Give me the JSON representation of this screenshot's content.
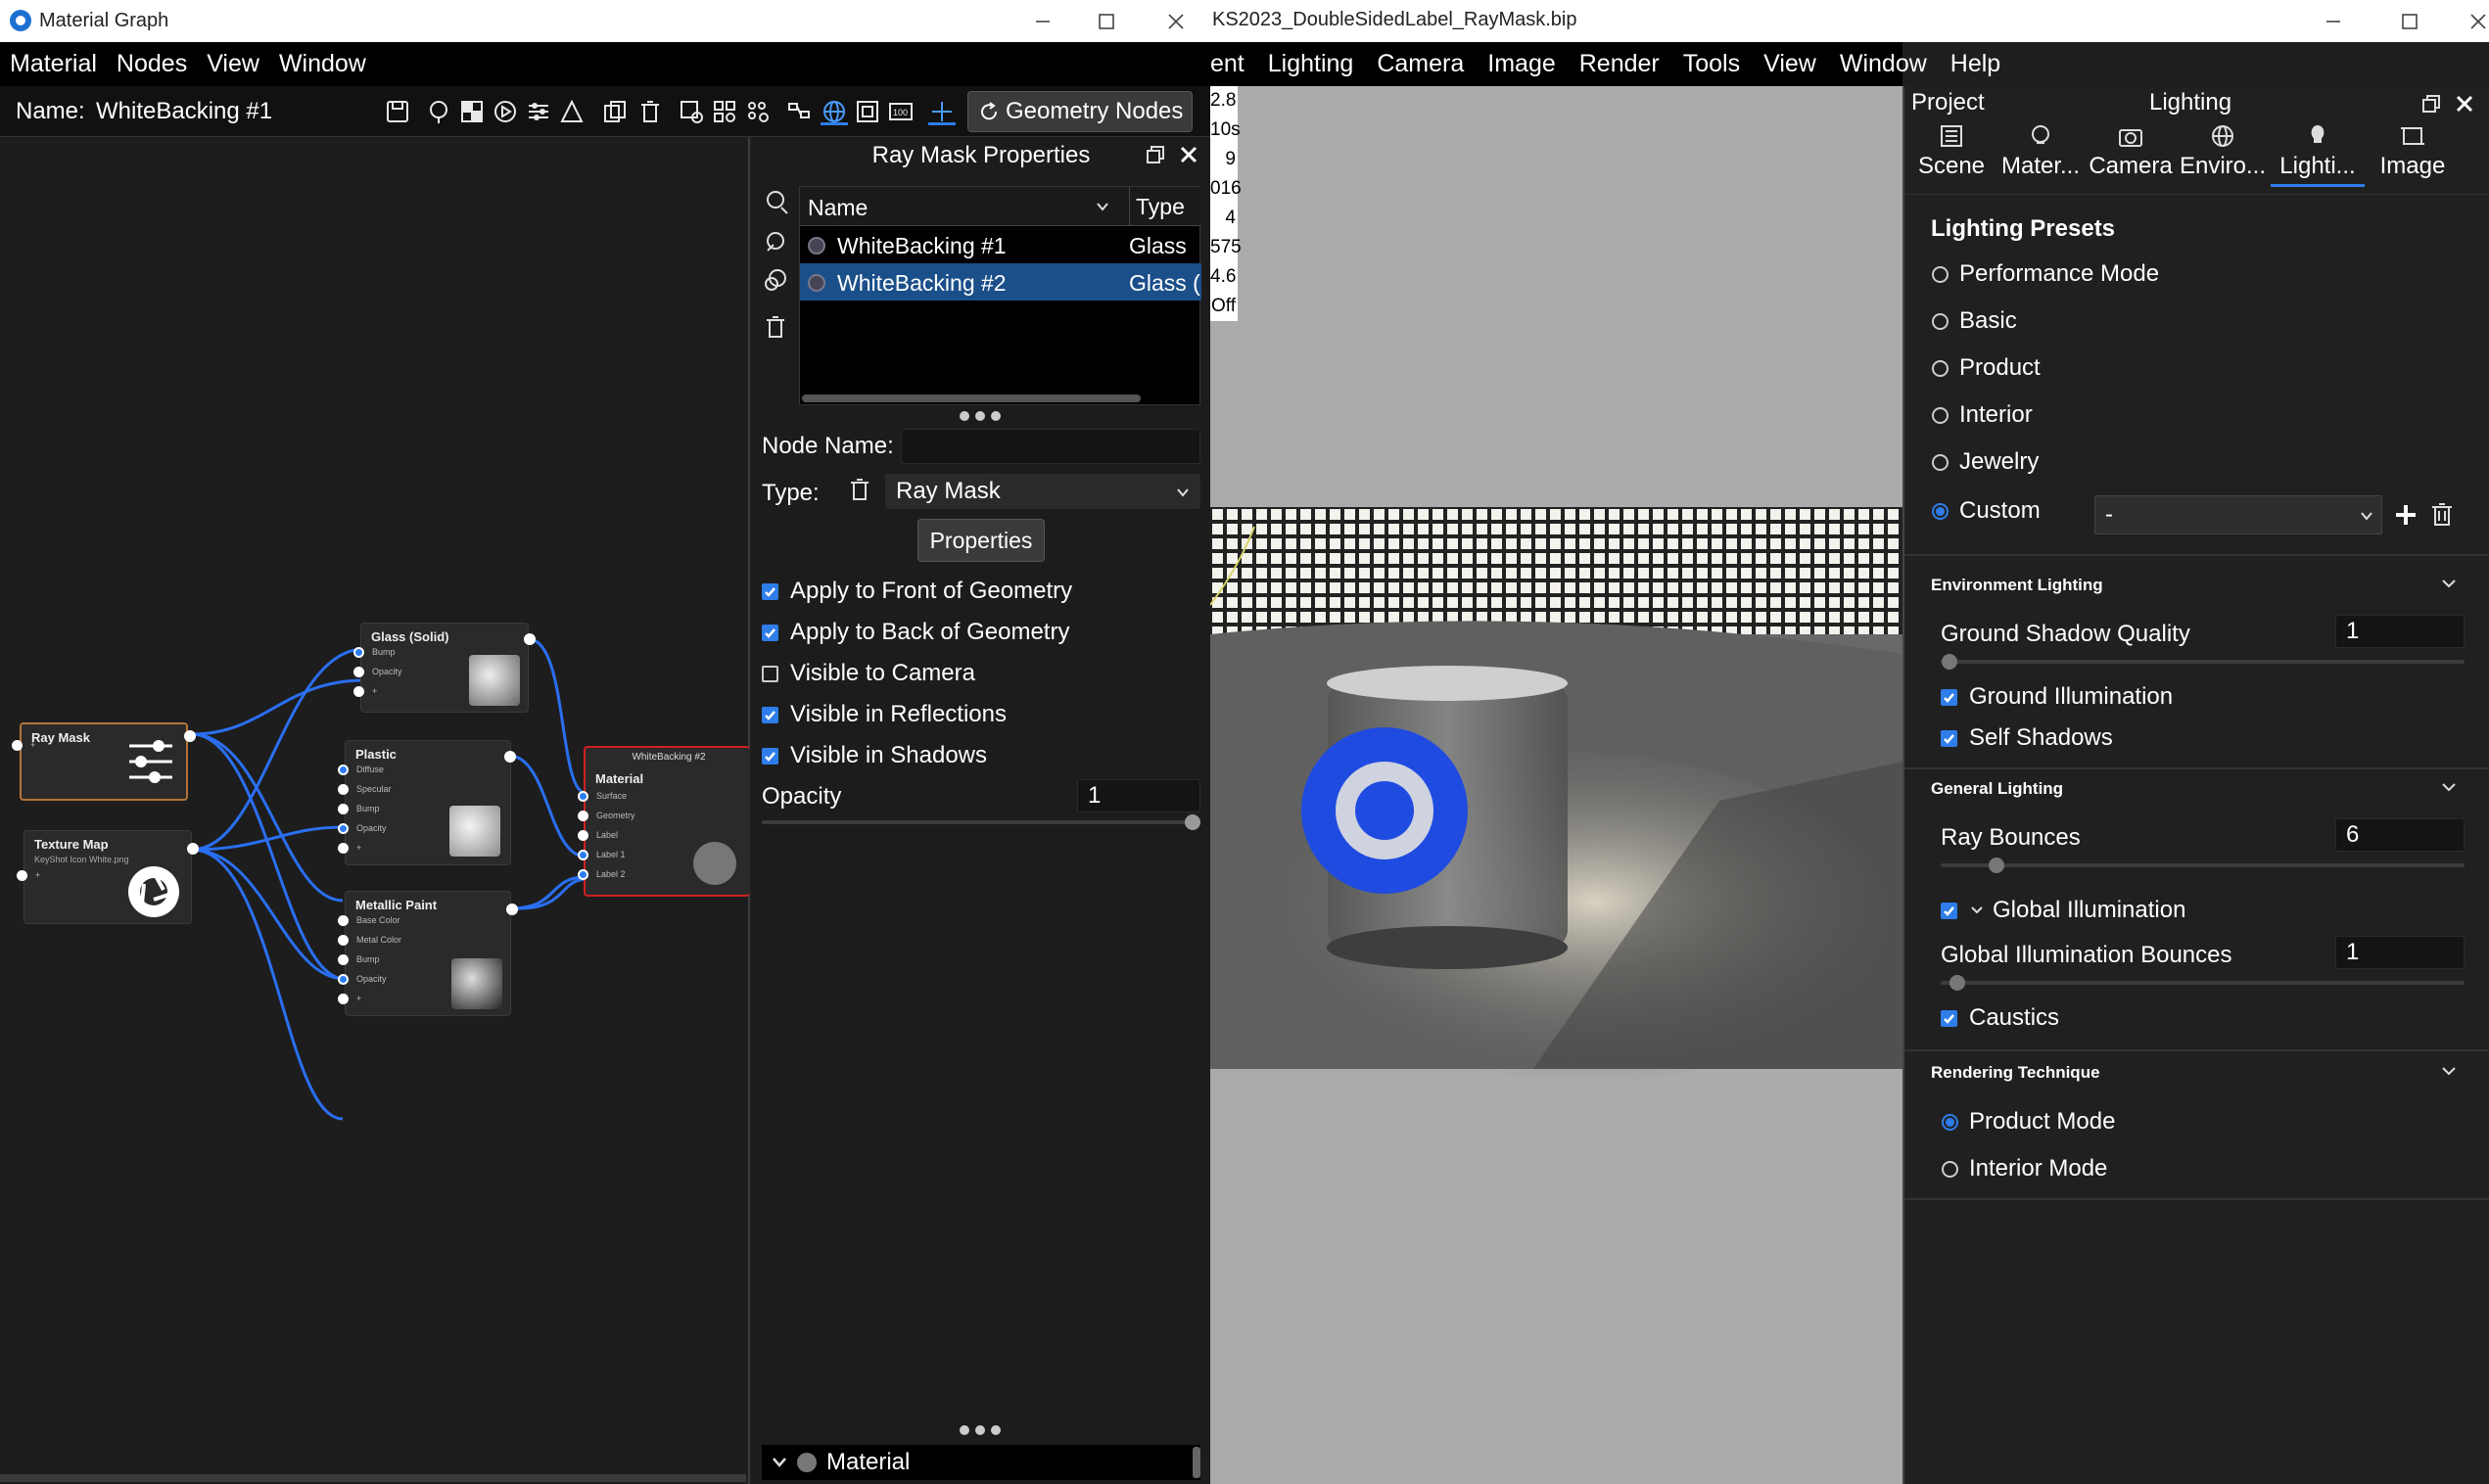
{
  "material_graph": {
    "window_title": "Material Graph",
    "menu": [
      "Material",
      "Nodes",
      "View",
      "Window"
    ],
    "name_label": "Name:",
    "name_value": "WhiteBacking #1",
    "geometry_nodes_label": "Geometry Nodes",
    "nodes": {
      "ray_mask": {
        "title": "Ray Mask",
        "port": "+"
      },
      "texture_map": {
        "title": "Texture Map",
        "subtitle": "KeyShot Icon White.png",
        "port": "+"
      },
      "glass": {
        "title": "Glass (Solid)",
        "ports": [
          "Bump",
          "Opacity",
          "+"
        ]
      },
      "plastic": {
        "title": "Plastic",
        "ports": [
          "Diffuse",
          "Specular",
          "Bump",
          "Opacity",
          "+"
        ]
      },
      "metallic": {
        "title": "Metallic Paint",
        "ports": [
          "Base Color",
          "Metal Color",
          "Bump",
          "Opacity",
          "+"
        ]
      },
      "whitebacking": {
        "header": "WhiteBacking #2",
        "title": "Material",
        "ports": [
          "Surface",
          "Geometry",
          "Label",
          "Label 1",
          "Label 2"
        ]
      }
    }
  },
  "ray_mask": {
    "panel_title": "Ray Mask Properties",
    "columns": [
      "Name",
      "Type"
    ],
    "rows": [
      {
        "name": "WhiteBacking #1",
        "type": "Glass"
      },
      {
        "name": "WhiteBacking #2",
        "type": "Glass (Solid)"
      }
    ],
    "node_name_label": "Node Name:",
    "node_name_value": "",
    "type_label": "Type:",
    "type_value": "Ray Mask",
    "properties_button": "Properties",
    "options": [
      {
        "label": "Apply to Front of Geometry",
        "checked": true
      },
      {
        "label": "Apply to Back of Geometry",
        "checked": true
      },
      {
        "label": "Visible to Camera",
        "checked": false
      },
      {
        "label": "Visible in Reflections",
        "checked": true
      },
      {
        "label": "Visible in Shadows",
        "checked": true
      }
    ],
    "opacity_label": "Opacity",
    "opacity_value": "1",
    "material_section": "Material"
  },
  "main": {
    "window_title": "KS2023_DoubleSidedLabel_RayMask.bip",
    "menu": [
      "ent",
      "Lighting",
      "Camera",
      "Image",
      "Render",
      "Tools",
      "View",
      "Window",
      "Help"
    ],
    "stats": [
      "2.8",
      "10s",
      "9",
      "016",
      "4",
      "575",
      "4.6",
      "Off"
    ]
  },
  "lighting": {
    "project_label": "Project",
    "panel_title": "Lighting",
    "tabs": [
      "Scene",
      "Mater...",
      "Camera",
      "Enviro...",
      "Lighti...",
      "Image"
    ],
    "active_tab": 4,
    "presets_title": "Lighting Presets",
    "presets": [
      "Performance Mode",
      "Basic",
      "Product",
      "Interior",
      "Jewelry",
      "Custom"
    ],
    "custom_value": "-",
    "environment": {
      "title": "Environment Lighting",
      "ground_shadow_quality_label": "Ground Shadow Quality",
      "ground_shadow_quality_value": "1",
      "ground_illumination": "Ground Illumination",
      "self_shadows": "Self Shadows"
    },
    "general": {
      "title": "General Lighting",
      "ray_bounces_label": "Ray Bounces",
      "ray_bounces_value": "6",
      "global_illumination": "Global Illumination",
      "gi_bounces_label": "Global Illumination Bounces",
      "gi_bounces_value": "1",
      "caustics": "Caustics"
    },
    "rendering": {
      "title": "Rendering Technique",
      "product_mode": "Product Mode",
      "interior_mode": "Interior Mode"
    }
  },
  "colors": {
    "accent": "#2e7de9",
    "selection": "#1b4f8a",
    "error_outline": "#d02020"
  }
}
